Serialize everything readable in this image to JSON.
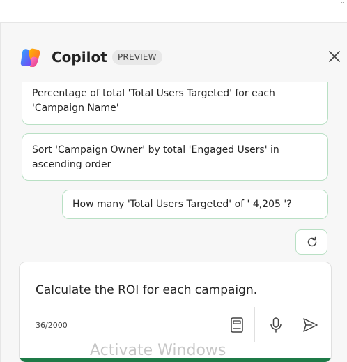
{
  "header": {
    "title": "Copilot",
    "badge": "PREVIEW",
    "logo_icon": "copilot-logo-icon",
    "close_icon": "close-icon"
  },
  "messages": [
    {
      "role": "suggestion",
      "text": "Percentage of total 'Total Users Targeted' for each 'Campaign Name'"
    },
    {
      "role": "suggestion",
      "text": "Sort 'Campaign Owner' by total 'Engaged Users' in ascending order"
    },
    {
      "role": "suggestion",
      "text": "How many 'Total Users Targeted' of ' 4,205 '?"
    }
  ],
  "refresh": {
    "icon": "refresh-icon"
  },
  "compose": {
    "value": "Calculate the ROI for each campaign.",
    "char_count": "36/2000",
    "icons": [
      "notebook-icon",
      "microphone-icon",
      "send-icon"
    ]
  },
  "watermark": "Activate Windows",
  "colors": {
    "accent": "#1e7a47",
    "bubble_border": "#b9e0c4",
    "pane_background": "#f7f7f7"
  }
}
